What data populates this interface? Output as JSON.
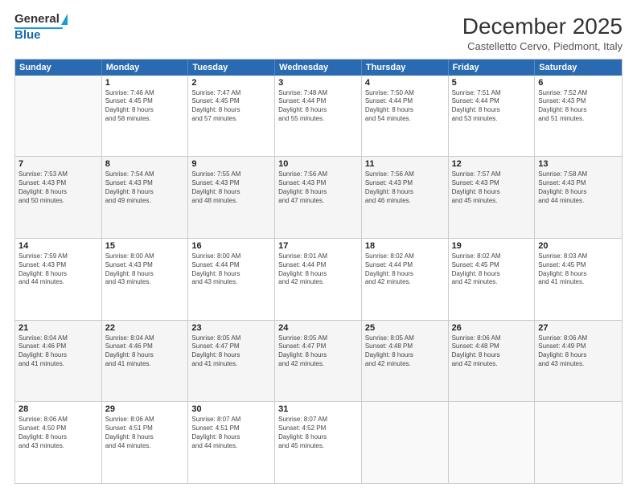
{
  "logo": {
    "line1": "General",
    "line2": "Blue"
  },
  "title": "December 2025",
  "subtitle": "Castelletto Cervo, Piedmont, Italy",
  "days": [
    "Sunday",
    "Monday",
    "Tuesday",
    "Wednesday",
    "Thursday",
    "Friday",
    "Saturday"
  ],
  "rows": [
    [
      {
        "day": "",
        "sunrise": "",
        "sunset": "",
        "daylight": ""
      },
      {
        "day": "1",
        "sunrise": "Sunrise: 7:46 AM",
        "sunset": "Sunset: 4:45 PM",
        "daylight": "Daylight: 8 hours",
        "daylight2": "and 58 minutes."
      },
      {
        "day": "2",
        "sunrise": "Sunrise: 7:47 AM",
        "sunset": "Sunset: 4:45 PM",
        "daylight": "Daylight: 8 hours",
        "daylight2": "and 57 minutes."
      },
      {
        "day": "3",
        "sunrise": "Sunrise: 7:48 AM",
        "sunset": "Sunset: 4:44 PM",
        "daylight": "Daylight: 8 hours",
        "daylight2": "and 55 minutes."
      },
      {
        "day": "4",
        "sunrise": "Sunrise: 7:50 AM",
        "sunset": "Sunset: 4:44 PM",
        "daylight": "Daylight: 8 hours",
        "daylight2": "and 54 minutes."
      },
      {
        "day": "5",
        "sunrise": "Sunrise: 7:51 AM",
        "sunset": "Sunset: 4:44 PM",
        "daylight": "Daylight: 8 hours",
        "daylight2": "and 53 minutes."
      },
      {
        "day": "6",
        "sunrise": "Sunrise: 7:52 AM",
        "sunset": "Sunset: 4:43 PM",
        "daylight": "Daylight: 8 hours",
        "daylight2": "and 51 minutes."
      }
    ],
    [
      {
        "day": "7",
        "sunrise": "Sunrise: 7:53 AM",
        "sunset": "Sunset: 4:43 PM",
        "daylight": "Daylight: 8 hours",
        "daylight2": "and 50 minutes."
      },
      {
        "day": "8",
        "sunrise": "Sunrise: 7:54 AM",
        "sunset": "Sunset: 4:43 PM",
        "daylight": "Daylight: 8 hours",
        "daylight2": "and 49 minutes."
      },
      {
        "day": "9",
        "sunrise": "Sunrise: 7:55 AM",
        "sunset": "Sunset: 4:43 PM",
        "daylight": "Daylight: 8 hours",
        "daylight2": "and 48 minutes."
      },
      {
        "day": "10",
        "sunrise": "Sunrise: 7:56 AM",
        "sunset": "Sunset: 4:43 PM",
        "daylight": "Daylight: 8 hours",
        "daylight2": "and 47 minutes."
      },
      {
        "day": "11",
        "sunrise": "Sunrise: 7:56 AM",
        "sunset": "Sunset: 4:43 PM",
        "daylight": "Daylight: 8 hours",
        "daylight2": "and 46 minutes."
      },
      {
        "day": "12",
        "sunrise": "Sunrise: 7:57 AM",
        "sunset": "Sunset: 4:43 PM",
        "daylight": "Daylight: 8 hours",
        "daylight2": "and 45 minutes."
      },
      {
        "day": "13",
        "sunrise": "Sunrise: 7:58 AM",
        "sunset": "Sunset: 4:43 PM",
        "daylight": "Daylight: 8 hours",
        "daylight2": "and 44 minutes."
      }
    ],
    [
      {
        "day": "14",
        "sunrise": "Sunrise: 7:59 AM",
        "sunset": "Sunset: 4:43 PM",
        "daylight": "Daylight: 8 hours",
        "daylight2": "and 44 minutes."
      },
      {
        "day": "15",
        "sunrise": "Sunrise: 8:00 AM",
        "sunset": "Sunset: 4:43 PM",
        "daylight": "Daylight: 8 hours",
        "daylight2": "and 43 minutes."
      },
      {
        "day": "16",
        "sunrise": "Sunrise: 8:00 AM",
        "sunset": "Sunset: 4:44 PM",
        "daylight": "Daylight: 8 hours",
        "daylight2": "and 43 minutes."
      },
      {
        "day": "17",
        "sunrise": "Sunrise: 8:01 AM",
        "sunset": "Sunset: 4:44 PM",
        "daylight": "Daylight: 8 hours",
        "daylight2": "and 42 minutes."
      },
      {
        "day": "18",
        "sunrise": "Sunrise: 8:02 AM",
        "sunset": "Sunset: 4:44 PM",
        "daylight": "Daylight: 8 hours",
        "daylight2": "and 42 minutes."
      },
      {
        "day": "19",
        "sunrise": "Sunrise: 8:02 AM",
        "sunset": "Sunset: 4:45 PM",
        "daylight": "Daylight: 8 hours",
        "daylight2": "and 42 minutes."
      },
      {
        "day": "20",
        "sunrise": "Sunrise: 8:03 AM",
        "sunset": "Sunset: 4:45 PM",
        "daylight": "Daylight: 8 hours",
        "daylight2": "and 41 minutes."
      }
    ],
    [
      {
        "day": "21",
        "sunrise": "Sunrise: 8:04 AM",
        "sunset": "Sunset: 4:46 PM",
        "daylight": "Daylight: 8 hours",
        "daylight2": "and 41 minutes."
      },
      {
        "day": "22",
        "sunrise": "Sunrise: 8:04 AM",
        "sunset": "Sunset: 4:46 PM",
        "daylight": "Daylight: 8 hours",
        "daylight2": "and 41 minutes."
      },
      {
        "day": "23",
        "sunrise": "Sunrise: 8:05 AM",
        "sunset": "Sunset: 4:47 PM",
        "daylight": "Daylight: 8 hours",
        "daylight2": "and 41 minutes."
      },
      {
        "day": "24",
        "sunrise": "Sunrise: 8:05 AM",
        "sunset": "Sunset: 4:47 PM",
        "daylight": "Daylight: 8 hours",
        "daylight2": "and 42 minutes."
      },
      {
        "day": "25",
        "sunrise": "Sunrise: 8:05 AM",
        "sunset": "Sunset: 4:48 PM",
        "daylight": "Daylight: 8 hours",
        "daylight2": "and 42 minutes."
      },
      {
        "day": "26",
        "sunrise": "Sunrise: 8:06 AM",
        "sunset": "Sunset: 4:48 PM",
        "daylight": "Daylight: 8 hours",
        "daylight2": "and 42 minutes."
      },
      {
        "day": "27",
        "sunrise": "Sunrise: 8:06 AM",
        "sunset": "Sunset: 4:49 PM",
        "daylight": "Daylight: 8 hours",
        "daylight2": "and 43 minutes."
      }
    ],
    [
      {
        "day": "28",
        "sunrise": "Sunrise: 8:06 AM",
        "sunset": "Sunset: 4:50 PM",
        "daylight": "Daylight: 8 hours",
        "daylight2": "and 43 minutes."
      },
      {
        "day": "29",
        "sunrise": "Sunrise: 8:06 AM",
        "sunset": "Sunset: 4:51 PM",
        "daylight": "Daylight: 8 hours",
        "daylight2": "and 44 minutes."
      },
      {
        "day": "30",
        "sunrise": "Sunrise: 8:07 AM",
        "sunset": "Sunset: 4:51 PM",
        "daylight": "Daylight: 8 hours",
        "daylight2": "and 44 minutes."
      },
      {
        "day": "31",
        "sunrise": "Sunrise: 8:07 AM",
        "sunset": "Sunset: 4:52 PM",
        "daylight": "Daylight: 8 hours",
        "daylight2": "and 45 minutes."
      },
      {
        "day": "",
        "sunrise": "",
        "sunset": "",
        "daylight": "",
        "daylight2": ""
      },
      {
        "day": "",
        "sunrise": "",
        "sunset": "",
        "daylight": "",
        "daylight2": ""
      },
      {
        "day": "",
        "sunrise": "",
        "sunset": "",
        "daylight": "",
        "daylight2": ""
      }
    ]
  ]
}
